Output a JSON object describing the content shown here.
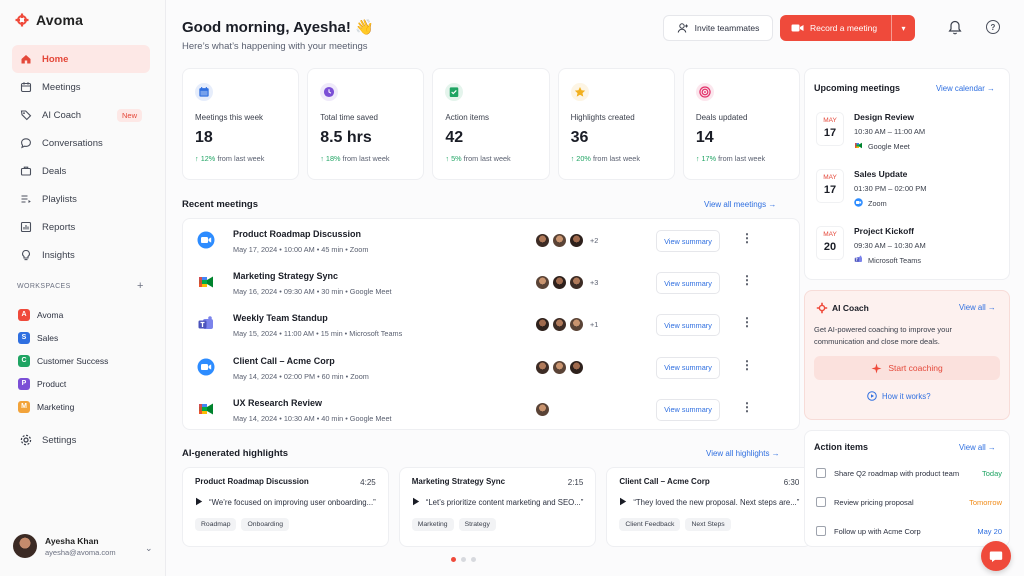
{
  "brand": {
    "name": "Avoma",
    "accent": "#ef4a3b"
  },
  "nav": {
    "items": [
      {
        "label": "Home",
        "icon": "home-icon",
        "active": true
      },
      {
        "label": "Meetings",
        "icon": "calendar-icon"
      },
      {
        "label": "AI Coach",
        "icon": "tag-icon",
        "badge": "New"
      },
      {
        "label": "Conversations",
        "icon": "chat-icon"
      },
      {
        "label": "Deals",
        "icon": "briefcase-icon"
      },
      {
        "label": "Playlists",
        "icon": "playlist-icon"
      },
      {
        "label": "Reports",
        "icon": "chart-icon"
      },
      {
        "label": "Insights",
        "icon": "bulb-icon"
      }
    ]
  },
  "workspaces": {
    "label": "WORKSPACES",
    "add": "+",
    "items": [
      {
        "letter": "A",
        "name": "Avoma",
        "color": "#ef4a3b"
      },
      {
        "letter": "S",
        "name": "Sales",
        "color": "#2f6fe0"
      },
      {
        "letter": "C",
        "name": "Customer Success",
        "color": "#1fa463"
      },
      {
        "letter": "P",
        "name": "Product",
        "color": "#7b4fd6"
      },
      {
        "letter": "M",
        "name": "Marketing",
        "color": "#f2a33a"
      }
    ]
  },
  "settings": {
    "label": "Settings"
  },
  "user": {
    "name": "Ayesha Khan",
    "email": "ayesha@avoma.com"
  },
  "header": {
    "greeting": "Good morning, Ayesha! 👋",
    "subtitle": "Here’s what’s happening with your meetings",
    "invite_label": "Invite teammates",
    "record_label": "Record a meeting"
  },
  "stats": [
    {
      "label": "Meetings this week",
      "value": "18",
      "delta": "12%",
      "delta_text": "from last week",
      "icon": "calendar-icon",
      "color": "#2f6fe0"
    },
    {
      "label": "Total time saved",
      "value": "8.5 hrs",
      "delta": "18%",
      "delta_text": "from last week",
      "icon": "clock-icon",
      "color": "#7b4fd6"
    },
    {
      "label": "Action items",
      "value": "42",
      "delta": "5%",
      "delta_text": "from last week",
      "icon": "checklist-icon",
      "color": "#1fa463"
    },
    {
      "label": "Highlights created",
      "value": "36",
      "delta": "20%",
      "delta_text": "from last week",
      "icon": "star-icon",
      "color": "#f2b01e"
    },
    {
      "label": "Deals updated",
      "value": "14",
      "delta": "17%",
      "delta_text": "from last week",
      "icon": "target-icon",
      "color": "#e2336b"
    }
  ],
  "recent": {
    "title": "Recent meetings",
    "link": "View all meetings →",
    "summary_label": "View summary",
    "rows": [
      {
        "title": "Product Roadmap Discussion",
        "date": "May 17, 2024",
        "time": "10:00 AM",
        "duration": "45 min",
        "platform": "Zoom",
        "app": "zoom",
        "attendees": 3,
        "more": "+2"
      },
      {
        "title": "Marketing Strategy Sync",
        "date": "May 16, 2024",
        "time": "09:30 AM",
        "duration": "30 min",
        "platform": "Google Meet",
        "app": "meet",
        "attendees": 3,
        "more": "+3"
      },
      {
        "title": "Weekly Team Standup",
        "date": "May 15, 2024",
        "time": "11:00 AM",
        "duration": "15 min",
        "platform": "Microsoft Teams",
        "app": "teams",
        "attendees": 3,
        "more": "+1"
      },
      {
        "title": "Client Call – Acme Corp",
        "date": "May 14, 2024",
        "time": "02:00 PM",
        "duration": "60 min",
        "platform": "Zoom",
        "app": "zoom",
        "attendees": 3,
        "more": ""
      },
      {
        "title": "UX Research Review",
        "date": "May 14, 2024",
        "time": "10:30 AM",
        "duration": "40 min",
        "platform": "Google Meet",
        "app": "meet",
        "attendees": 1,
        "more": ""
      }
    ]
  },
  "highlights": {
    "title": "AI-generated highlights",
    "link": "View all highlights →",
    "cards": [
      {
        "title": "Product Roadmap Discussion",
        "time": "4:25",
        "quote": "“We’re focused on improving user onboarding...”",
        "tags": [
          "Roadmap",
          "Onboarding"
        ]
      },
      {
        "title": "Marketing Strategy Sync",
        "time": "2:15",
        "quote": "“Let’s prioritize content marketing and SEO...”",
        "tags": [
          "Marketing",
          "Strategy"
        ]
      },
      {
        "title": "Client Call – Acme Corp",
        "time": "6:30",
        "quote": "“They loved the new proposal. Next steps are...”",
        "tags": [
          "Client Feedback",
          "Next Steps"
        ]
      }
    ],
    "page_index": 0,
    "page_count": 3
  },
  "upcoming": {
    "title": "Upcoming meetings",
    "link": "View calendar →",
    "items": [
      {
        "month": "MAY",
        "day": "17",
        "name": "Design Review",
        "time": "10:30 AM – 11:00 AM",
        "platform": "Google Meet",
        "app": "meet"
      },
      {
        "month": "MAY",
        "day": "17",
        "name": "Sales Update",
        "time": "01:30 PM – 02:00 PM",
        "platform": "Zoom",
        "app": "zoom"
      },
      {
        "month": "MAY",
        "day": "20",
        "name": "Project Kickoff",
        "time": "09:30 AM – 10:30 AM",
        "platform": "Microsoft Teams",
        "app": "teams"
      }
    ]
  },
  "coach": {
    "title": "AI Coach",
    "link": "View all →",
    "desc": "Get AI-powered coaching to improve your communication and close more deals.",
    "button": "Start coaching",
    "how": "How it works?"
  },
  "actions": {
    "title": "Action items",
    "link": "View all →",
    "items": [
      {
        "text": "Share Q2 roadmap with product team",
        "due": "Today",
        "color": "#1fa463"
      },
      {
        "text": "Review pricing proposal",
        "due": "Tomorrow",
        "color": "#f08c1a"
      },
      {
        "text": "Follow up with Acme Corp",
        "due": "May 20",
        "color": "#2f6fe0"
      }
    ]
  }
}
